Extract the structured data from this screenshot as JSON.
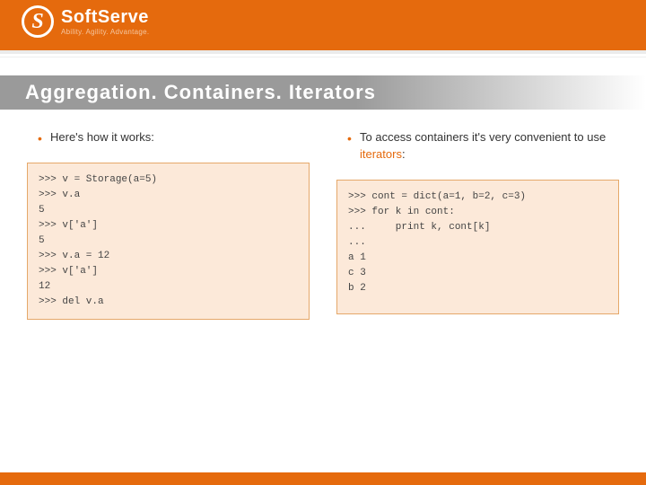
{
  "brand": {
    "name_primary": "Soft",
    "name_secondary": "Serve",
    "tagline": "Ability. Agility. Advantage."
  },
  "title": "Aggregation.  Containers.  Iterators",
  "left": {
    "bullet": "Here's how it works:",
    "code": ">>> v = Storage(a=5)\n>>> v.a\n5\n>>> v['a']\n5\n>>> v.a = 12\n>>> v['a']\n12\n>>> del v.a"
  },
  "right": {
    "bullet_pre": "To access containers it's very convenient to use ",
    "bullet_hl": "iterators",
    "bullet_post": ":",
    "code": ">>> cont = dict(a=1, b=2, c=3)\n>>> for k in cont:\n...     print k, cont[k]\n...\na 1\nc 3\nb 2"
  }
}
